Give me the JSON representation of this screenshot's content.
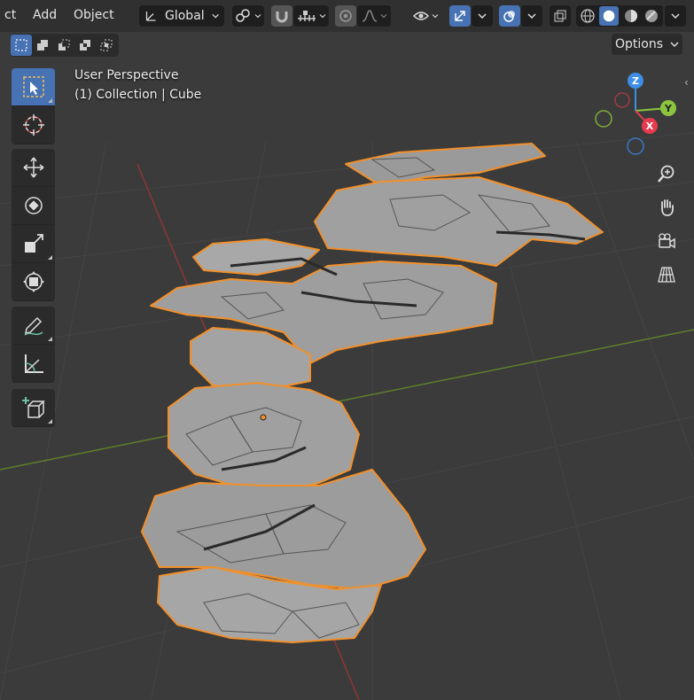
{
  "menu": {
    "item_ct": "ct",
    "add": "Add",
    "object": "Object"
  },
  "header": {
    "orientation_label": "Global",
    "transform_pivot_icon": "pivot-icon",
    "snap_icon": "magnet-icon",
    "proportional_icon": "proportional-edit-icon",
    "shading_modes": [
      "wireframe",
      "solid",
      "material-preview",
      "rendered"
    ],
    "active_shading": "solid"
  },
  "select_modes": [
    "set-new",
    "extend",
    "subtract",
    "difference",
    "intersect"
  ],
  "options_label": "Options",
  "viewport_info": {
    "perspective": "User Perspective",
    "collection": "(1) Collection | Cube"
  },
  "tools": [
    {
      "name": "select-box",
      "active": true
    },
    {
      "name": "cursor"
    },
    {
      "name": "move"
    },
    {
      "name": "rotate"
    },
    {
      "name": "scale"
    },
    {
      "name": "transform"
    },
    {
      "name": "annotate"
    },
    {
      "name": "measure"
    },
    {
      "name": "add-cube"
    }
  ],
  "gizmo": {
    "z_label": "Z",
    "y_label": "Y",
    "x_label": "X",
    "x_color": "#e63b4e",
    "y_color": "#8bc43f",
    "z_color": "#3d8ee6"
  },
  "nav": [
    "zoom-icon",
    "hand-icon",
    "camera-icon",
    "grid-view-icon"
  ],
  "colors": {
    "selection_outline": "#f1902b",
    "active_button": "#4772b3",
    "viewport_bg": "#3b3b3b",
    "header_bg": "#303030",
    "x_axis_line": "#9b3a3a",
    "y_axis_line": "#6a8a2a"
  }
}
